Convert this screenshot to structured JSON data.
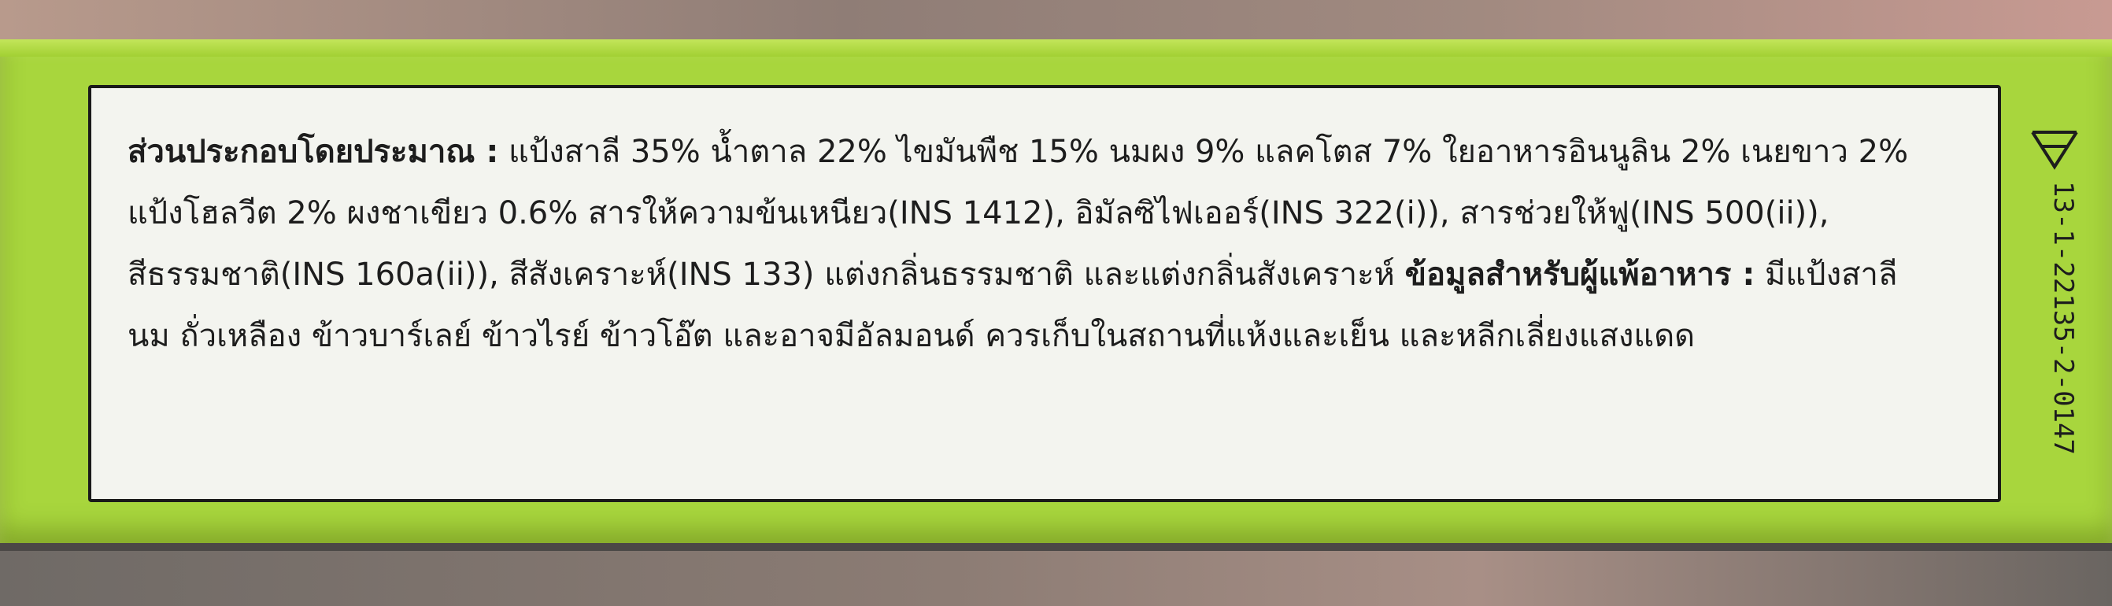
{
  "label": {
    "ingredients_heading": "ส่วนประกอบโดยประมาณ :",
    "ingredients_body": " แป้งสาลี 35% น้ำตาล 22% ไขมันพืช 15% นมผง 9% แลคโตส 7% ใยอาหารอินนูลิน 2% เนยขาว 2%\nแป้งโฮลวีต 2% ผงชาเขียว 0.6% สารให้ความข้นเหนียว(INS 1412), อิมัลซิไฟเออร์(INS 322(i)), สารช่วยให้ฟู(INS 500(ii)),\nสีธรรมชาติ(INS 160a(ii)), สีสังเคราะห์(INS 133) แต่งกลิ่นธรรมชาติ และแต่งกลิ่นสังเคราะห์  ",
    "allergen_heading": "ข้อมูลสำหรับผู้แพ้อาหาร :",
    "allergen_body": " มีแป้งสาลี\nนม ถั่วเหลือง ข้าวบาร์เลย์ ข้าวไรย์ ข้าวโอ๊ต และอาจมีอัลมอนด์  ควรเก็บในสถานที่แห้งและเย็น และหลีกเลี่ยงแสงแดด",
    "batch_code": "13-1-22135-2-0147"
  },
  "colors": {
    "box_green": "#a8d63d",
    "label_background": "#f3f4ef",
    "text": "#1d1d1d"
  }
}
